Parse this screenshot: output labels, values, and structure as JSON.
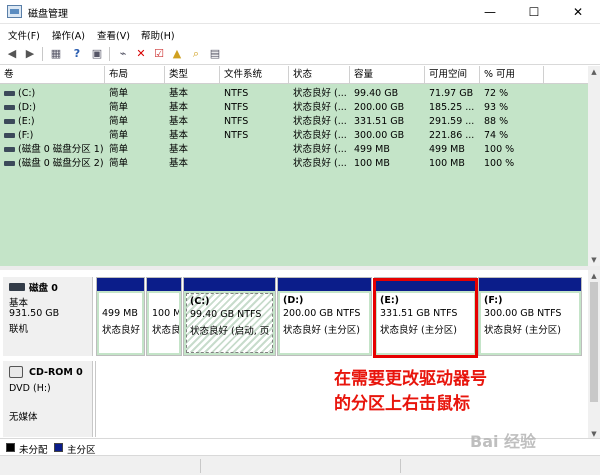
{
  "window": {
    "title": "磁盘管理"
  },
  "menu": [
    "文件(F)",
    "操作(A)",
    "查看(V)",
    "帮助(H)"
  ],
  "volumes": {
    "columns": [
      "卷",
      "布局",
      "类型",
      "文件系统",
      "状态",
      "容量",
      "可用空间",
      "% 可用"
    ],
    "rows": [
      [
        "(C:)",
        "简单",
        "基本",
        "NTFS",
        "状态良好 (...",
        "99.40 GB",
        "71.97 GB",
        "72 %"
      ],
      [
        "(D:)",
        "简单",
        "基本",
        "NTFS",
        "状态良好 (...",
        "200.00 GB",
        "185.25 ...",
        "93 %"
      ],
      [
        "(E:)",
        "简单",
        "基本",
        "NTFS",
        "状态良好 (...",
        "331.51 GB",
        "291.59 ...",
        "88 %"
      ],
      [
        "(F:)",
        "简单",
        "基本",
        "NTFS",
        "状态良好 (...",
        "300.00 GB",
        "221.86 ...",
        "74 %"
      ],
      [
        "(磁盘 0 磁盘分区 1)",
        "简单",
        "基本",
        "",
        "状态良好 (...",
        "499 MB",
        "499 MB",
        "100 %"
      ],
      [
        "(磁盘 0 磁盘分区 2)",
        "简单",
        "基本",
        "",
        "状态良好 (...",
        "100 MB",
        "100 MB",
        "100 %"
      ]
    ]
  },
  "disk0": {
    "name": "磁盘 0",
    "type": "基本",
    "size": "931.50 GB",
    "status": "联机",
    "partitions": [
      {
        "name": "",
        "size": "499 MB",
        "status": "状态良好"
      },
      {
        "name": "",
        "size": "100 M",
        "status": "状态良"
      },
      {
        "name": "(C:)",
        "size": "99.40 GB NTFS",
        "status": "状态良好 (启动, 页"
      },
      {
        "name": "(D:)",
        "size": "200.00 GB NTFS",
        "status": "状态良好 (主分区)"
      },
      {
        "name": "(E:)",
        "size": "331.51 GB NTFS",
        "status": "状态良好 (主分区)"
      },
      {
        "name": "(F:)",
        "size": "300.00 GB NTFS",
        "status": "状态良好 (主分区)"
      }
    ]
  },
  "cdrom": {
    "name": "CD-ROM 0",
    "type": "DVD (H:)",
    "status": "无媒体"
  },
  "legend": [
    "未分配",
    "主分区"
  ],
  "annotation": [
    "在需要更改驱动器号",
    "的分区上右击鼠标"
  ],
  "watermark": "Bai 经验",
  "colors": {
    "primary_partition": "#0b1d8a",
    "unallocated": "#000000",
    "volume_bg": "#c4e4c8",
    "annotation": "#e8150c"
  }
}
